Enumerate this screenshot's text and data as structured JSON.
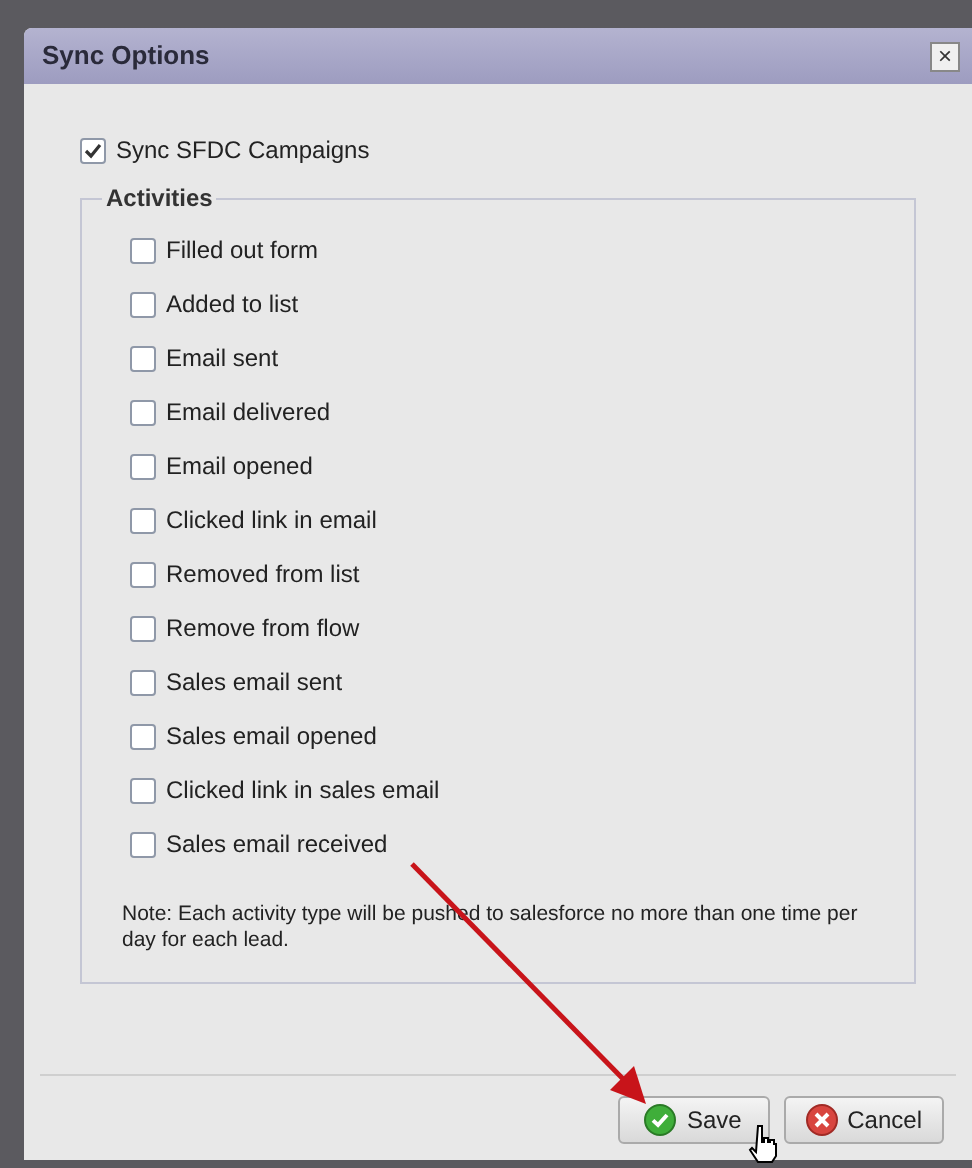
{
  "dialog": {
    "title": "Sync Options",
    "close": "×"
  },
  "sync_campaigns": {
    "label": "Sync SFDC Campaigns",
    "checked": true
  },
  "activities": {
    "legend": "Activities",
    "items": [
      {
        "label": "Filled out form",
        "checked": false
      },
      {
        "label": "Added to list",
        "checked": false
      },
      {
        "label": "Email sent",
        "checked": false
      },
      {
        "label": "Email delivered",
        "checked": false
      },
      {
        "label": "Email opened",
        "checked": false
      },
      {
        "label": "Clicked link in email",
        "checked": false
      },
      {
        "label": "Removed from list",
        "checked": false
      },
      {
        "label": "Remove from flow",
        "checked": false
      },
      {
        "label": "Sales email sent",
        "checked": false
      },
      {
        "label": "Sales email opened",
        "checked": false
      },
      {
        "label": "Clicked link in sales email",
        "checked": false
      },
      {
        "label": "Sales email received",
        "checked": false
      }
    ],
    "note": "Note: Each activity type will be pushed to salesforce no more than one time per day for each lead."
  },
  "buttons": [
    {
      "label": "Save",
      "kind": "save"
    },
    {
      "label": "Cancel",
      "kind": "cancel"
    }
  ]
}
